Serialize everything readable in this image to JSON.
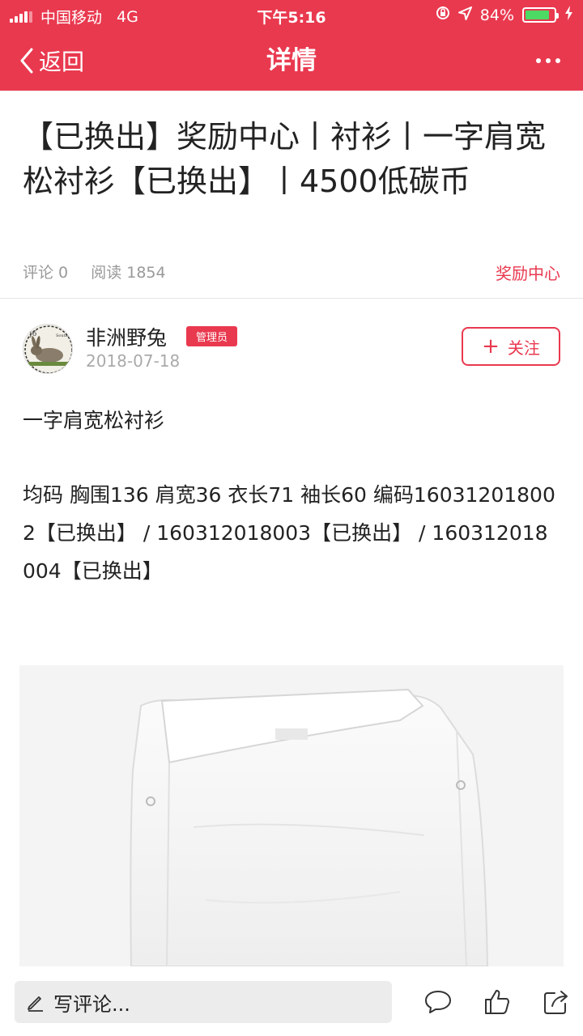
{
  "status_bar": {
    "carrier": "中国移动",
    "network": "4G",
    "time": "下午5:16",
    "battery": "84%",
    "battery_level": 0.84
  },
  "nav": {
    "back_label": "返回",
    "title": "详情"
  },
  "article": {
    "title": "【已换出】奖励中心丨衬衫丨一字肩宽松衬衫【已换出】丨4500低碳币",
    "comments": "评论 0",
    "reads": "阅读 1854",
    "category": "奖励中心"
  },
  "author": {
    "name": "非洲野兔",
    "badge": "管理员",
    "date": "2018-07-18",
    "follow_label": "关注"
  },
  "content": {
    "paragraph_1": "一字肩宽松衬衫",
    "paragraph_2": "均码  胸围136   肩宽36  衣长71  袖长60   编码160312018002【已换出】 / 160312018003【已换出】 / 160312018004【已换出】"
  },
  "bottom_bar": {
    "comment_placeholder": "写评论..."
  },
  "colors": {
    "accent": "#e9394f",
    "battery": "#4cd964"
  }
}
